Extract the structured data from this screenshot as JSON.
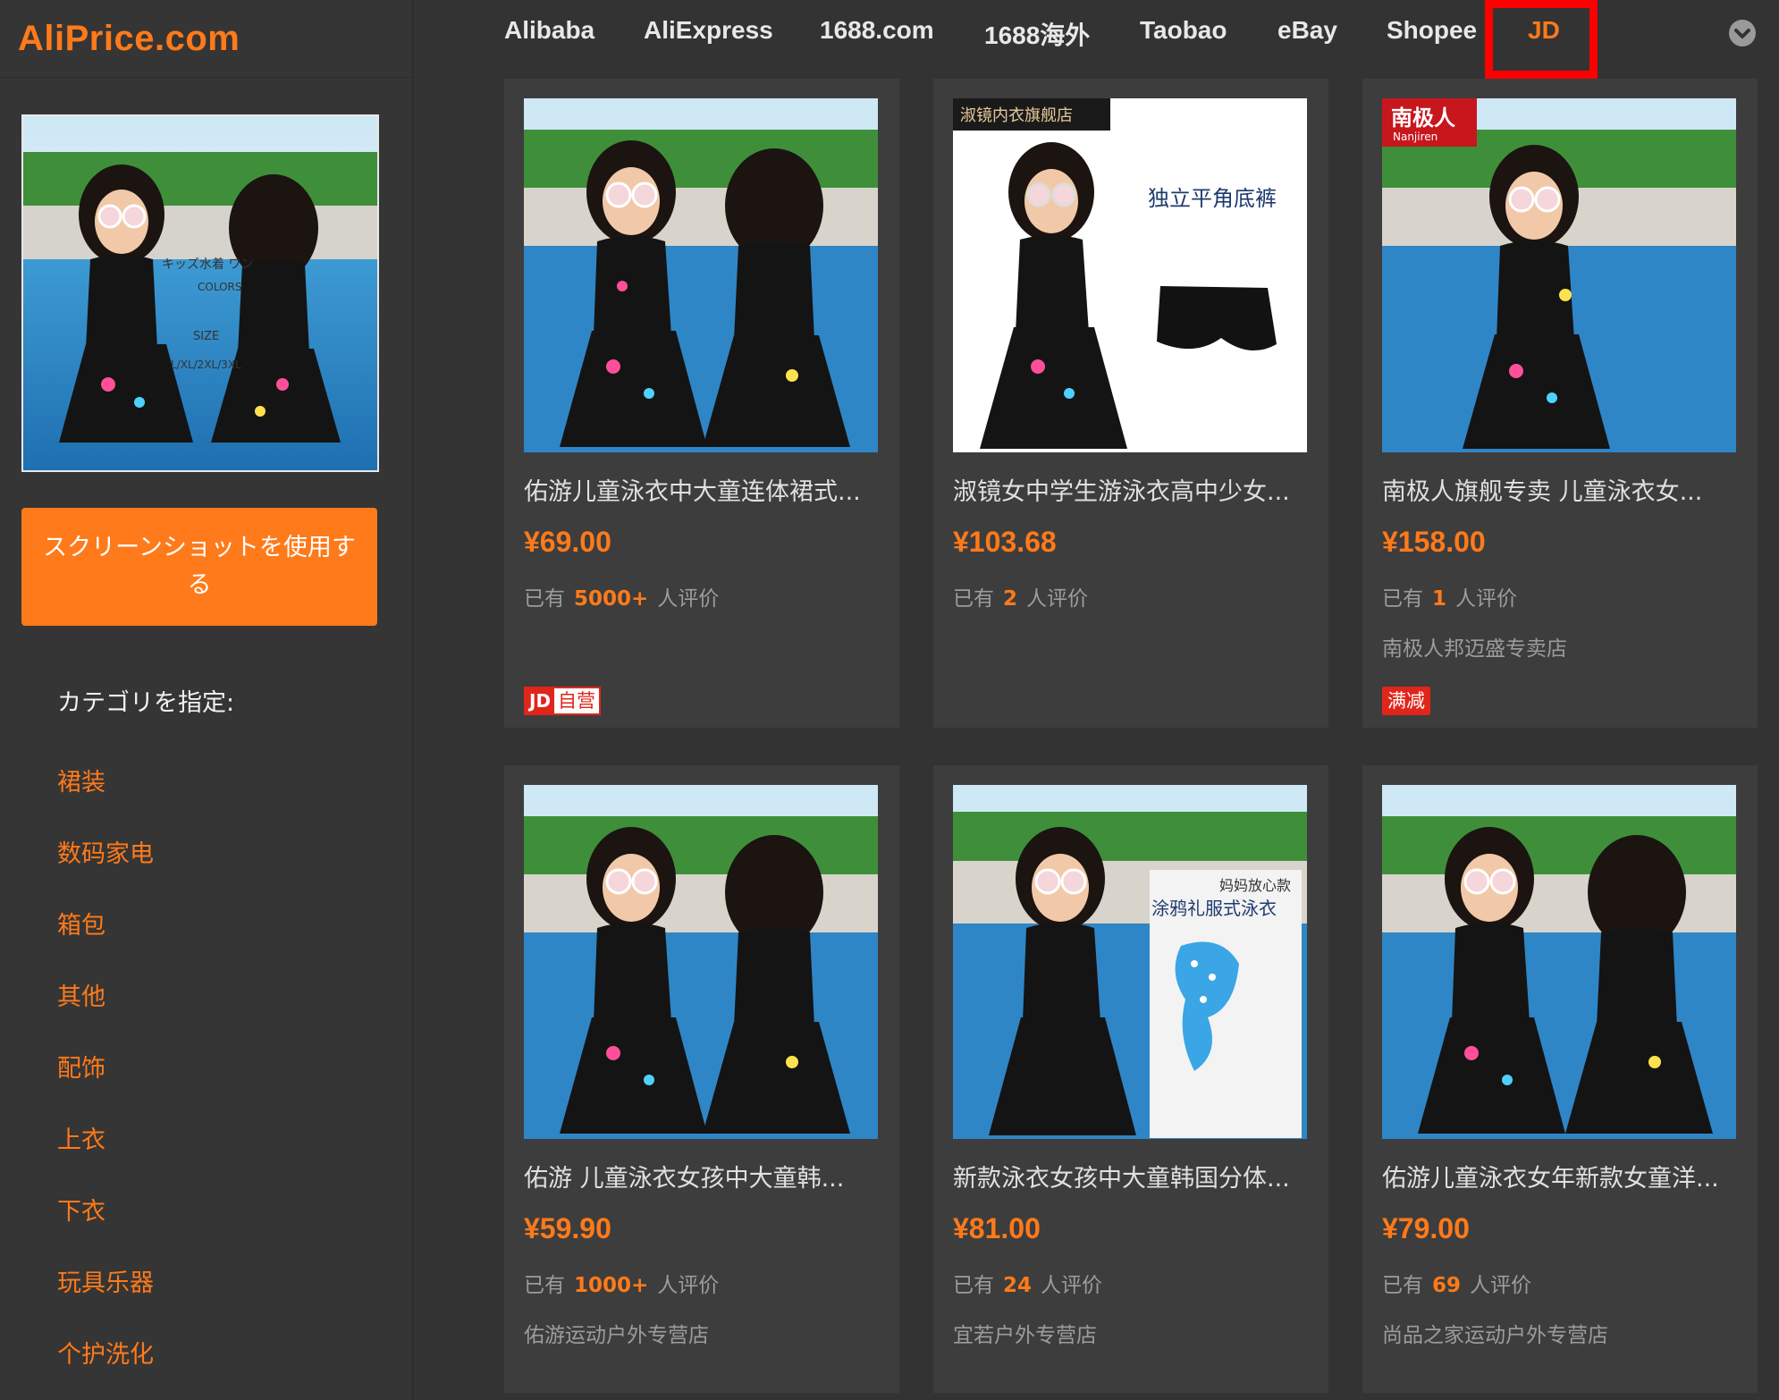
{
  "app": {
    "logo": "AliPrice.com"
  },
  "sidebar": {
    "screenshot_button": "スクリーンショットを使用する",
    "category_title": "カテゴリを指定:",
    "categories": [
      "裙装",
      "数码家电",
      "箱包",
      "其他",
      "配饰",
      "上衣",
      "下衣",
      "玩具乐器",
      "个护洗化"
    ],
    "preview_overlay": {
      "line1": "キッズ水着 ワン",
      "line2": "COLORS",
      "line3": "SIZE",
      "line4": "L/XL/2XL/3XL"
    }
  },
  "nav": {
    "items": [
      "Alibaba",
      "AliExpress",
      "1688.com",
      "1688海外",
      "Taobao",
      "eBay",
      "Shopee",
      "JD"
    ],
    "active": "JD"
  },
  "products": [
    {
      "title": "佑游儿童泳衣中大童连体裙式...",
      "price": "¥69.00",
      "reviews_prefix": "已有",
      "reviews_count": "5000+",
      "reviews_suffix": "人评价",
      "store": "",
      "badge": "JD自营"
    },
    {
      "title": "淑镜女中学生游泳衣高中少女...",
      "price": "¥103.68",
      "reviews_prefix": "已有",
      "reviews_count": "2",
      "reviews_suffix": "人评价",
      "store": "",
      "badge": "",
      "image_text": {
        "shop": "淑镜内衣旗舰店",
        "caption": "独立平角底裤"
      }
    },
    {
      "title": "南极人旗舰专卖 儿童泳衣女...",
      "price": "¥158.00",
      "reviews_prefix": "已有",
      "reviews_count": "1",
      "reviews_suffix": "人评价",
      "store": "南极人邦迈盛专卖店",
      "badge": "满减",
      "image_text": {
        "brand": "南极人",
        "brand_sub": "Nanjiren"
      }
    },
    {
      "title": "佑游 儿童泳衣女孩中大童韩...",
      "price": "¥59.90",
      "reviews_prefix": "已有",
      "reviews_count": "1000+",
      "reviews_suffix": "人评价",
      "store": "佑游运动户外专营店",
      "badge": ""
    },
    {
      "title": "新款泳衣女孩中大童韩国分体...",
      "price": "¥81.00",
      "reviews_prefix": "已有",
      "reviews_count": "24",
      "reviews_suffix": "人评价",
      "store": "宜若户外专营店",
      "badge": "",
      "image_text": {
        "tag1": "妈妈放心款",
        "tag2": "涂鸦礼服式泳衣"
      }
    },
    {
      "title": "佑游儿童泳衣女年新款女童洋...",
      "price": "¥79.00",
      "reviews_prefix": "已有",
      "reviews_count": "69",
      "reviews_suffix": "人评价",
      "store": "尚品之家运动户外专营店",
      "badge": ""
    }
  ],
  "badges": {
    "jd_self_jd": "JD",
    "jd_self_text": "自营"
  },
  "colors": {
    "accent": "#ff7a1a",
    "background": "#333333",
    "card": "#3d3d3d",
    "highlight": "#ff0000"
  }
}
